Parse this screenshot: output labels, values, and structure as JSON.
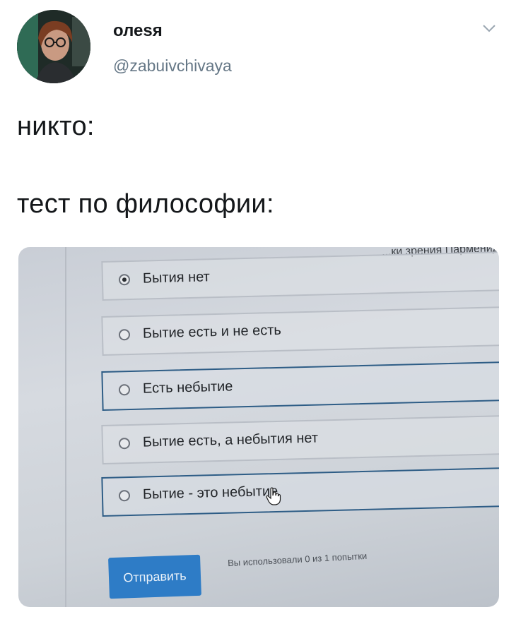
{
  "tweet": {
    "display_name": "олеsя",
    "handle": "@zabuivchivaya",
    "line1": "никто:",
    "line2": "тест по философии:"
  },
  "photo": {
    "top_partial_text": "...ки зрения Парменид",
    "options": [
      {
        "label": "Бытия нет",
        "checked": true
      },
      {
        "label": "Бытие есть и не есть",
        "checked": false
      },
      {
        "label": "Есть небытие",
        "checked": false
      },
      {
        "label": "Бытие есть, а небытия нет",
        "checked": false
      },
      {
        "label": "Бытие - это небытие",
        "checked": false
      }
    ],
    "submit_label": "Отправить",
    "attempts_text": "Вы использовали 0 из 1 попытки"
  },
  "colors": {
    "accent_blue": "#2e7cc6",
    "handle_gray": "#657786",
    "text_dark": "#14171a"
  },
  "icons": {
    "caret": "chevron-down-icon",
    "cursor": "hand-cursor-icon"
  }
}
